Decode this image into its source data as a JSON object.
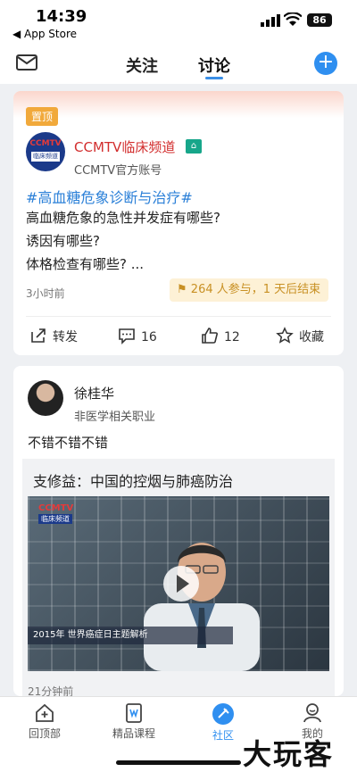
{
  "status_bar": {
    "time": "14:39",
    "back_label": "◀ App Store",
    "battery": "86"
  },
  "top_nav": {
    "tabs": [
      "关注",
      "讨论"
    ],
    "active_tab": "讨论"
  },
  "pinned_post": {
    "badge": "置顶",
    "account_name": "CCMTV临床频道",
    "account_sub": "CCMTV官方账号",
    "logo_top": "CCMTV",
    "logo_bottom": "临床频道",
    "topic": "#高血糖危象诊断与治疗#",
    "lines": [
      "高血糖危象的急性并发症有哪些?",
      "诱因有哪些?",
      "体格检查有哪些? ..."
    ],
    "time": "3小时前",
    "participation": "264 人参与，1 天后结束",
    "actions": {
      "forward": "转发",
      "comments": "16",
      "likes": "12",
      "collect": "收藏"
    }
  },
  "user_post": {
    "user_name": "徐桂华",
    "user_role": "非医学相关职业",
    "content": "不错不错不错",
    "shared_title": "支修益：中国的控烟与肺癌防治",
    "video_logo": "CCMTV",
    "video_logo_sub": "临床频道",
    "video_caption": "2015年 世界癌症日主题解析",
    "time": "21分钟前"
  },
  "bottom_nav": {
    "items": [
      "回顶部",
      "精品课程",
      "社区",
      "我的"
    ],
    "active": "社区"
  },
  "watermark": "大玩客",
  "colors": {
    "accent": "#2f8ff0",
    "pin": "#f1a93b",
    "account_red": "#d22d2d",
    "topic_blue": "#2b80d8"
  }
}
